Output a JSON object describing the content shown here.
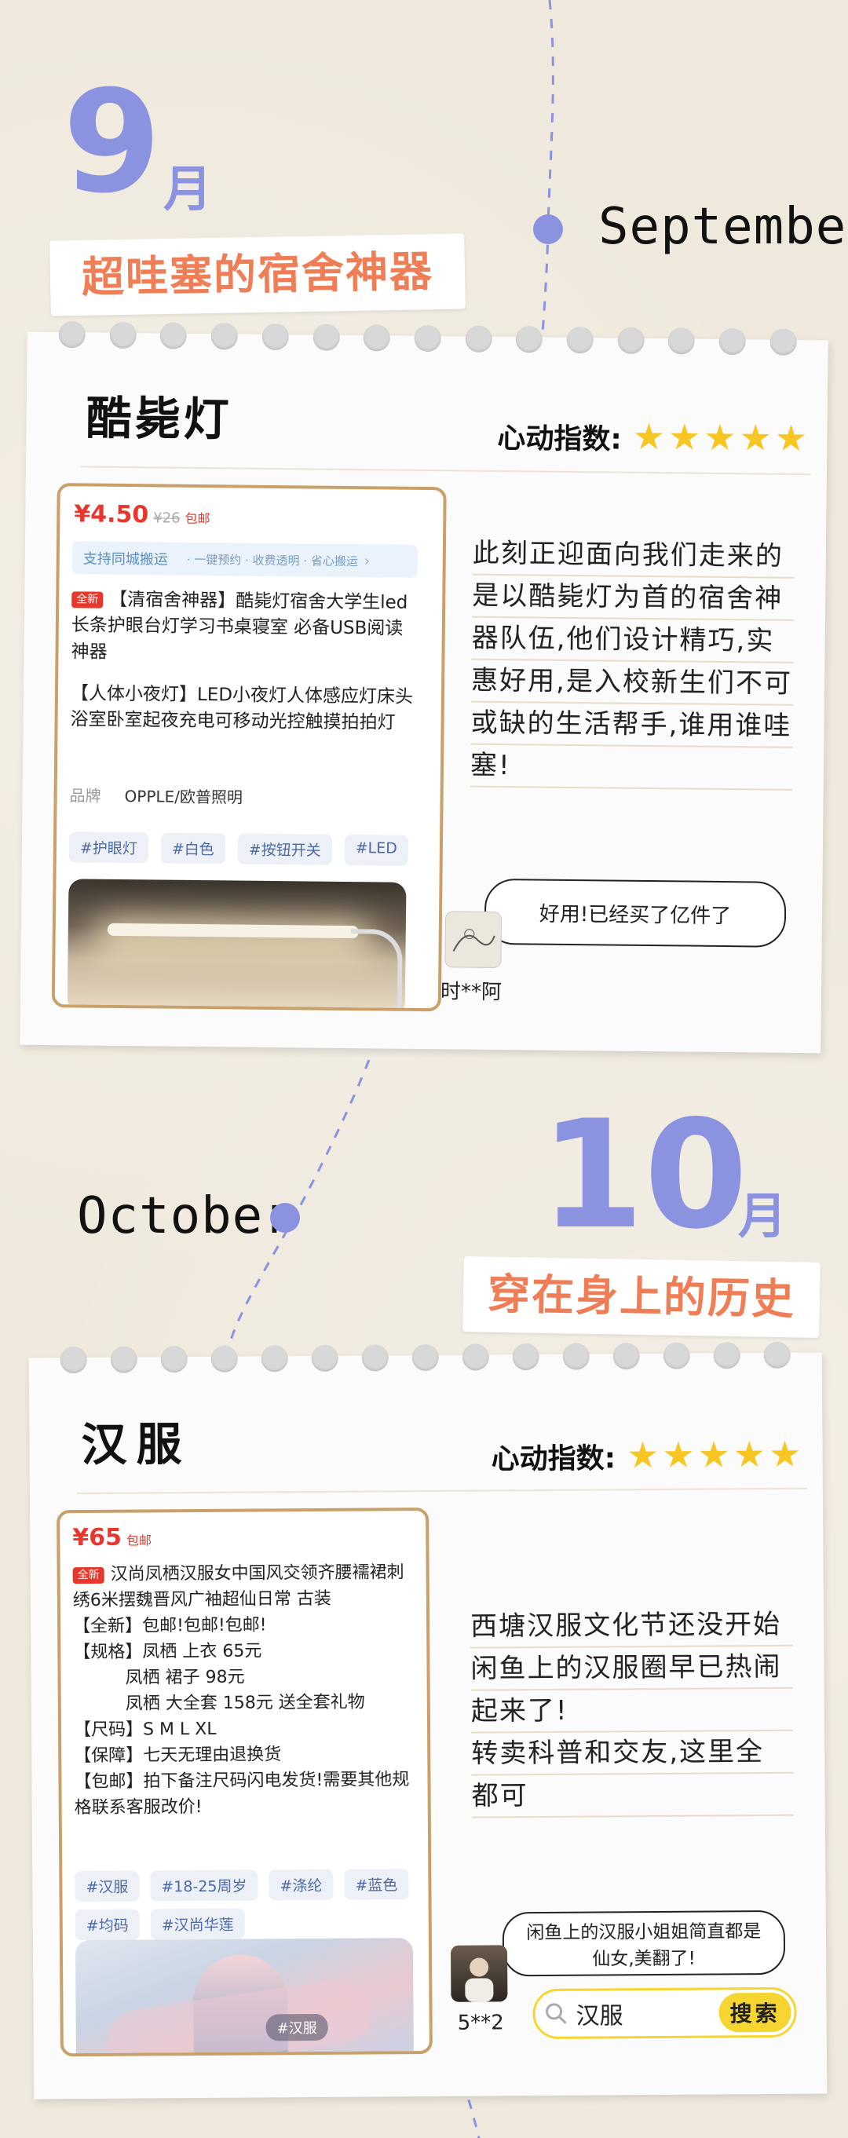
{
  "sections": [
    {
      "month_number": "9",
      "month_unit": "月",
      "month_english": "September",
      "banner": "超哇塞的宿舍神器",
      "product_name": "酷毙灯",
      "rating_label": "心动指数:",
      "rating_stars": 5,
      "listing": {
        "price": "¥4.50",
        "old_price": "¥26",
        "shipping": "包邮",
        "service_label": "支持同城搬运",
        "service_tags": "· 一键预约  · 收费透明  · 省心搬运",
        "new_tag": "全新",
        "title": "【清宿舍神器】酷毙灯宿舍大学生led长条护眼台灯学习书桌寝室 必备USB阅读神器",
        "subtitle": "【人体小夜灯】LED小夜灯人体感应灯床头浴室卧室起夜充电可移动光控触摸拍拍灯",
        "brand_label": "品牌",
        "brand_value": "OPPLE/欧普照明",
        "tags": [
          "#护眼灯",
          "#白色",
          "#按钮开关",
          "#LED"
        ]
      },
      "description": [
        "此刻正迎面向我们走来的",
        "是以酷毙灯为首的宿舍神",
        "器队伍,他们设计精巧,实",
        "惠好用,是入校新生们不可",
        "或缺的生活帮手,谁用谁哇",
        "塞!"
      ],
      "comment": "好用!已经买了亿件了",
      "commenter": "时**阿"
    },
    {
      "month_number": "10",
      "month_unit": "月",
      "month_english": "October",
      "banner": "穿在身上的历史",
      "product_name": "汉服",
      "rating_label": "心动指数:",
      "rating_stars": 5,
      "listing": {
        "price": "¥65",
        "shipping": "包邮",
        "new_tag": "全新",
        "lines": [
          "汉尚凤栖汉服女中国风交领齐腰襦裙刺绣6米摆魏晋风广袖超仙日常 古装",
          "【全新】包邮!包邮!包邮!",
          "【规格】凤栖 上衣 65元",
          "凤栖 裙子 98元",
          "凤栖 大全套 158元 送全套礼物",
          "【尺码】S M L XL",
          "【保障】七天无理由退换货",
          "【包邮】拍下备注尺码闪电发货!需要其他规格联系客服改价!"
        ],
        "tags": [
          "#汉服",
          "#18-25周岁",
          "#涤纶",
          "#蓝色",
          "#均码",
          "#汉尚华莲"
        ],
        "image_tag": "#汉服"
      },
      "description": [
        "西塘汉服文化节还没开始",
        "闲鱼上的汉服圈早已热闹",
        "起来了!",
        "转卖科普和交友,这里全",
        "都可"
      ],
      "comment": "闲鱼上的汉服小姐姐简直都是仙女,美翻了!",
      "commenter": "5**2",
      "search_text": "汉服",
      "search_button": "搜索"
    }
  ],
  "colors": {
    "background": "#efe9dd",
    "accent_purple": "#8b93e0",
    "accent_orange": "#ef7d56",
    "star": "#f7c623",
    "price_red": "#e8372c",
    "search_yellow": "#f7d530"
  }
}
